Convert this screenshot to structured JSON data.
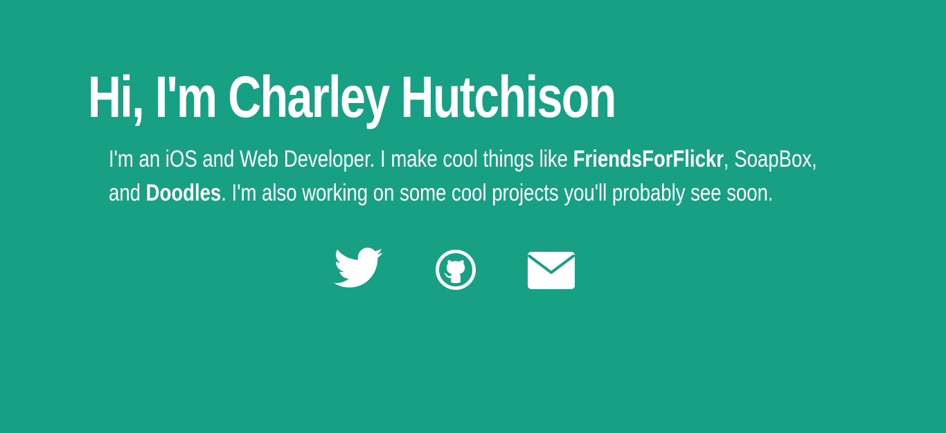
{
  "hero": {
    "title": "Hi, I'm Charley Hutchison"
  },
  "bio": {
    "intro": "I'm an iOS and Web Developer. I make cool things like ",
    "project_1": "FriendsForFlickr",
    "sep_1": ", ",
    "project_2": "SoapBox",
    "sep_2": ", and ",
    "project_3": "Doodles",
    "outro": ". I'm also working on some cool projects you'll probably see soon."
  },
  "social": {
    "icons": [
      "twitter-icon",
      "github-icon",
      "mail-icon"
    ]
  },
  "colors": {
    "background": "#18a085",
    "text": "#ffffff"
  }
}
